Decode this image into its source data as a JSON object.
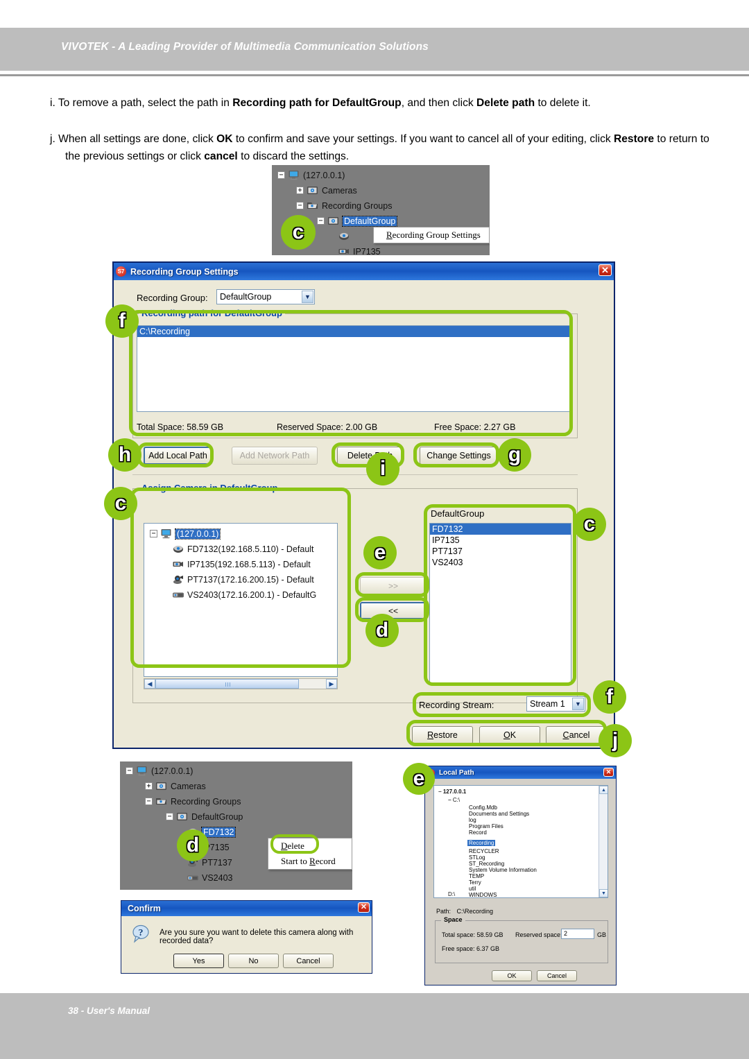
{
  "page": {
    "header_title": "VIVOTEK - A Leading Provider of Multimedia Communication Solutions",
    "footer_text": "38 - User's Manual",
    "accent_green": "#8cc516",
    "header_grey": "#bdbdbd"
  },
  "instructions": [
    {
      "marker": "i.",
      "part1": "To remove a path, select the path in ",
      "bold1": "Recording path for DefaultGroup",
      "part2": ", and then click ",
      "bold2": "Delete path",
      "part3": " to delete it."
    },
    {
      "marker": "j.",
      "part1": "When all settings are done, click ",
      "bold1": "OK",
      "part2": " to confirm and save your settings. If you want to cancel all of your editing, click ",
      "bold2": "Restore",
      "part3": " to return to the previous settings or click ",
      "bold3": "cancel",
      "part4": " to discard the settings."
    }
  ],
  "top_tree": {
    "root": "(127.0.0.1)",
    "cameras": "Cameras",
    "recording_groups": "Recording Groups",
    "default_group": "DefaultGroup",
    "ip7135": "IP7135",
    "context_menu": "Recording Group Settings",
    "callout": "c"
  },
  "main_dialog": {
    "title": "Recording Group Settings",
    "title_icon": "st7-app-icon",
    "close_icon": "close-icon",
    "recording_group_label": "Recording Group:",
    "recording_group_value": "DefaultGroup",
    "path_group_title": "Recording path for DefaultGroup",
    "paths": [
      "C:\\Recording"
    ],
    "total_space": "Total Space: 58.59 GB",
    "reserved_space": "Reserved Space: 2.00 GB",
    "free_space": "Free Space: 2.27 GB",
    "buttons": {
      "add_local_path": "Add Local Path",
      "add_network_path": "Add Network Path",
      "delete_path": "Delete Path",
      "change_settings": "Change Settings"
    },
    "assign_group_title": "Assign Camera in DefaultGroup",
    "camera_tree": {
      "root": "(127.0.0.1)",
      "items": [
        "FD7132(192.168.5.110) - Default",
        "IP7135(192.168.5.113) - Default",
        "PT7137(172.16.200.15) - Default",
        "VS2403(172.16.200.1) - DefaultG"
      ]
    },
    "transfer": {
      "add": ">>",
      "remove": "<<"
    },
    "assigned_title": "DefaultGroup",
    "assigned_list": [
      "FD7132",
      "IP7135",
      "PT7137",
      "VS2403"
    ],
    "recording_stream_label": "Recording Stream:",
    "recording_stream_value": "Stream 1",
    "footer_buttons": {
      "restore": "Restore",
      "ok": "OK",
      "cancel": "Cancel"
    },
    "callouts": {
      "path_group": "f",
      "add_local": "h",
      "delete_path": "i",
      "change_settings": "g",
      "assign_group": "c",
      "assigned_list": "c",
      "add_btn": "e",
      "remove_btn": "d",
      "stream": "f",
      "footer": "j"
    }
  },
  "bottom_tree": {
    "root": "(127.0.0.1)",
    "cameras": "Cameras",
    "recording_groups": "Recording Groups",
    "default_group": "DefaultGroup",
    "cameras_list": [
      "FD7132",
      "IP7135",
      "PT7137",
      "VS2403"
    ],
    "context_menu": {
      "delete": "Delete",
      "start_record": "Start to Record"
    },
    "callout": "d"
  },
  "confirm_dialog": {
    "title": "Confirm",
    "icon": "question-icon",
    "message": "Are you sure you want to delete this camera along with recorded data?",
    "buttons": {
      "yes": "Yes",
      "no": "No",
      "cancel": "Cancel"
    }
  },
  "local_path_dialog": {
    "title": "Local Path",
    "callout": "e",
    "tree_root": "127.0.0.1",
    "drive": "C:\\",
    "folders": [
      "Config.Mdb",
      "Documents and Settings",
      "log",
      "Program Files",
      "Record",
      "Recording",
      "RECYCLER",
      "STLog",
      "ST_Recording",
      "System Volume Information",
      "TEMP",
      "Terry",
      "util",
      "WINDOWS"
    ],
    "selected_folder": "Recording",
    "next_drive": "D:\\",
    "path_label": "Path:",
    "path_value": "C:\\Recording",
    "space_group": "Space",
    "total_space": "Total space: 58.59 GB",
    "reserved_label": "Reserved space:",
    "reserved_value": "2",
    "reserved_unit": "GB",
    "free_space": "Free space: 6.37 GB",
    "buttons": {
      "ok": "OK",
      "cancel": "Cancel"
    }
  }
}
